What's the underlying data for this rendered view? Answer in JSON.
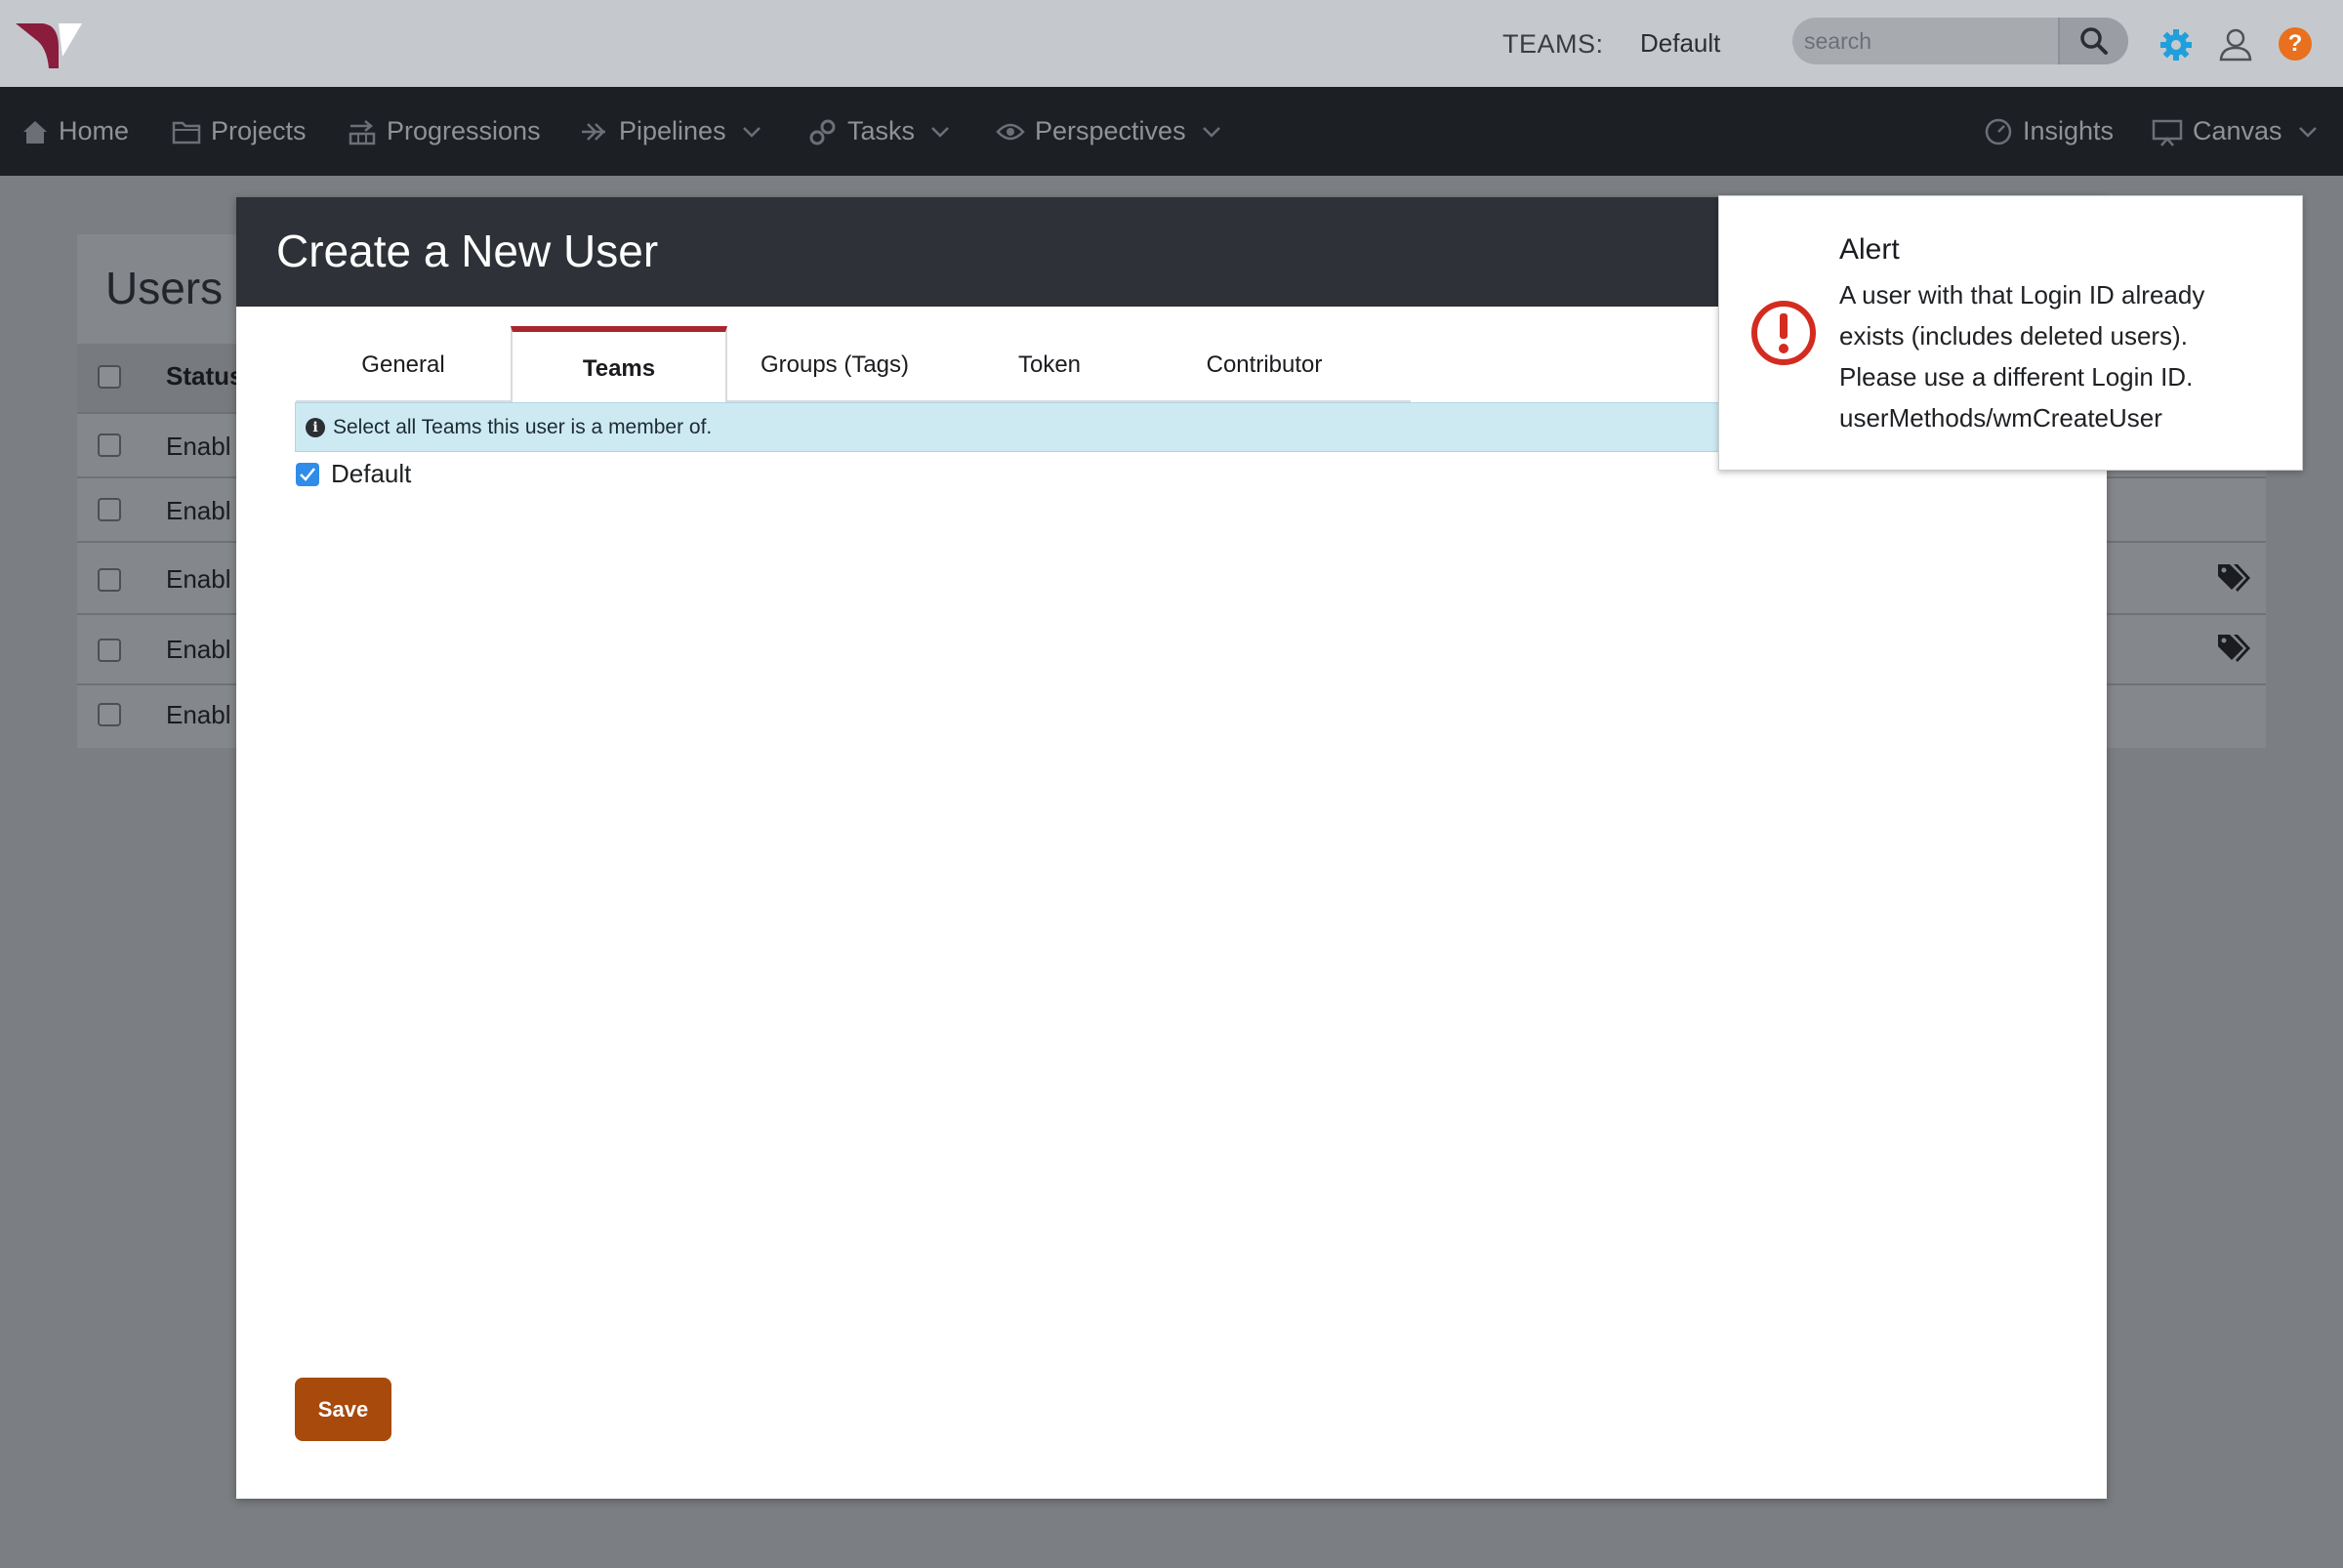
{
  "topbar": {
    "teams_label": "TEAMS:",
    "teams_value": "Default",
    "search_placeholder": "search"
  },
  "nav": {
    "items": [
      {
        "label": "Home",
        "icon": "home-icon"
      },
      {
        "label": "Projects",
        "icon": "folder-icon"
      },
      {
        "label": "Progressions",
        "icon": "progressions-icon"
      },
      {
        "label": "Pipelines",
        "icon": "arrows-icon",
        "dropdown": true
      },
      {
        "label": "Tasks",
        "icon": "gears-icon",
        "dropdown": true
      },
      {
        "label": "Perspectives",
        "icon": "eye-icon",
        "dropdown": true
      },
      {
        "label": "Insights",
        "icon": "gauge-icon"
      },
      {
        "label": "Canvas",
        "icon": "canvas-icon",
        "dropdown": true
      }
    ]
  },
  "background_page": {
    "title": "Users",
    "status_header": "Status",
    "rows": [
      {
        "status": "Enabl",
        "tag": false
      },
      {
        "status": "Enabl",
        "tag": false
      },
      {
        "status": "Enabl",
        "tag": true
      },
      {
        "status": "Enabl",
        "tag": true
      },
      {
        "status": "Enabl",
        "tag": false
      }
    ]
  },
  "modal": {
    "title": "Create a New User",
    "tabs": [
      "General",
      "Teams",
      "Groups (Tags)",
      "Token",
      "Contributor"
    ],
    "active_tab": "Teams",
    "info_text": "Select all Teams this user is a member of.",
    "team_option": {
      "label": "Default",
      "checked": true
    },
    "save_label": "Save"
  },
  "alert": {
    "title": "Alert",
    "lines": [
      "A user with that Login ID already",
      "exists (includes deleted users).",
      "Please use a different Login ID.",
      "userMethods/wmCreateUser"
    ],
    "icon": "exclamation-circle-icon"
  },
  "colors": {
    "accent_tab": "#a8262d",
    "save_button": "#a84a0c",
    "alert_icon": "#d42b20",
    "gear": "#1fa0dc",
    "help": "#e8701e",
    "checkbox": "#2f8ce8"
  }
}
